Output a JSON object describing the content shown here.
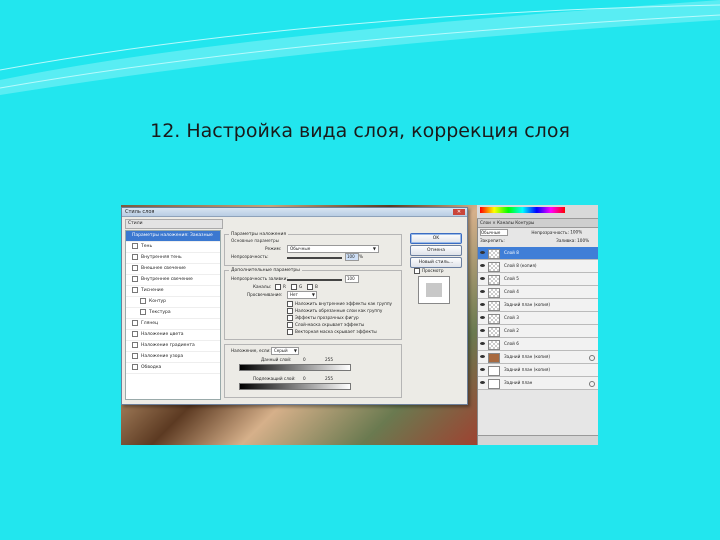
{
  "slide": {
    "title": "12. Настройка вида слоя, коррекция слоя"
  },
  "dialog": {
    "title": "Стиль слоя",
    "styles_header": "Стили",
    "styles": [
      {
        "label": "Параметры наложения: Заказные",
        "selected": true,
        "checkbox": false
      },
      {
        "label": "Тень",
        "checkbox": true
      },
      {
        "label": "Внутренняя тень",
        "checkbox": true
      },
      {
        "label": "Внешнее свечение",
        "checkbox": true
      },
      {
        "label": "Внутреннее свечение",
        "checkbox": true
      },
      {
        "label": "Тиснение",
        "checkbox": true
      },
      {
        "label": "Контур",
        "checkbox": true
      },
      {
        "label": "Текстура",
        "checkbox": true
      },
      {
        "label": "Глянец",
        "checkbox": true
      },
      {
        "label": "Наложение цвета",
        "checkbox": true
      },
      {
        "label": "Наложение градиента",
        "checkbox": true
      },
      {
        "label": "Наложение узора",
        "checkbox": true
      },
      {
        "label": "Обводка",
        "checkbox": true
      }
    ],
    "blend": {
      "legend": "Параметры наложения",
      "general_legend": "Основные параметры",
      "mode_label": "Режим:",
      "mode_value": "Обычные",
      "opacity_label": "Непрозрачность:",
      "opacity_value": "100",
      "pct": "%"
    },
    "advanced": {
      "legend": "Дополнительные параметры",
      "fill_label": "Непрозрачность заливки:",
      "fill_value": "100",
      "channels_label": "Каналы:",
      "channels": [
        "R",
        "G",
        "B"
      ],
      "knockout_label": "Просвечивание:",
      "knockout_value": "Нет",
      "options": [
        "Наложить внутренние эффекты как группу",
        "Наложить обрезанные слои как группу",
        "Эффекты прозрачных фигур",
        "Слой-маска скрывает эффекты",
        "Векторная маска скрывает эффекты"
      ]
    },
    "blend_if": {
      "label": "Наложение, если:",
      "value": "Серый",
      "this_layer": "Данный слой:",
      "this_min": "0",
      "this_max": "255",
      "below_layer": "Подлежащий слой:",
      "below_min": "0",
      "below_max": "255"
    },
    "buttons": {
      "ok": "OK",
      "cancel": "Отмена",
      "new_style": "Новый стиль...",
      "preview": "Просмотр"
    },
    "close_glyph": "✕"
  },
  "layers_panel": {
    "tabs": "Слои × Каналы  Контуры",
    "blend_mode": "Обычные",
    "opacity_label": "Непрозрачность:",
    "opacity_value": "100%",
    "lock_label": "Закрепить:",
    "fill_label": "Заливка:",
    "fill_value": "100%",
    "layers": [
      {
        "name": "Слой 8",
        "selected": true
      },
      {
        "name": "Слой 8 (копия)"
      },
      {
        "name": "Слой 5"
      },
      {
        "name": "Слой 4"
      },
      {
        "name": "Задний план (копия)"
      },
      {
        "name": "Слой 3"
      },
      {
        "name": "Слой 2"
      },
      {
        "name": "Слой 6"
      },
      {
        "name": "Задний план (копия)"
      },
      {
        "name": "Задний план (копия)"
      },
      {
        "name": "Задний план"
      }
    ]
  },
  "colors": {
    "background": "#22e6ee",
    "selection": "#3f7ed7"
  }
}
